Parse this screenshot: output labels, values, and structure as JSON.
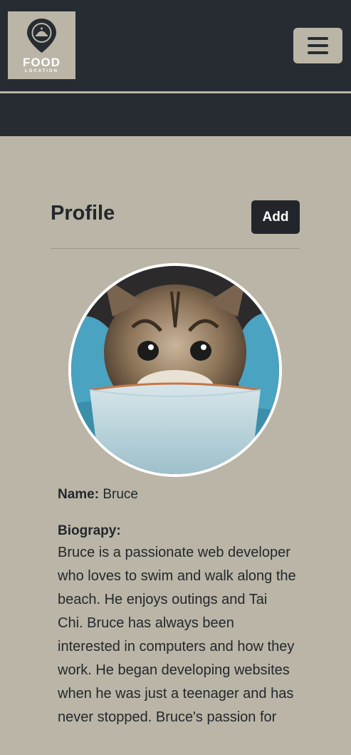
{
  "brand": {
    "logo_word": "FOOD",
    "logo_sub": "LOCATION",
    "logo_icon": "map-pin-food-icon"
  },
  "nav": {
    "menu_icon": "hamburger-icon"
  },
  "profile": {
    "title": "Profile",
    "add_label": "Add",
    "photo_alt": "kitten-in-bowl-photo",
    "name_label": "Name:",
    "name_value": "Bruce",
    "bio_label": "Biograpy:",
    "bio_text": "Bruce is a passionate web developer who loves to swim and walk along the beach. He enjoys outings and Tai Chi. Bruce has always been interested in computers and how they work. He began developing websites when he was just a teenager and has never stopped. Bruce's passion for"
  },
  "colors": {
    "nav_bg": "#262c32",
    "page_bg": "#bab5a6",
    "button_dark": "#22262b"
  }
}
